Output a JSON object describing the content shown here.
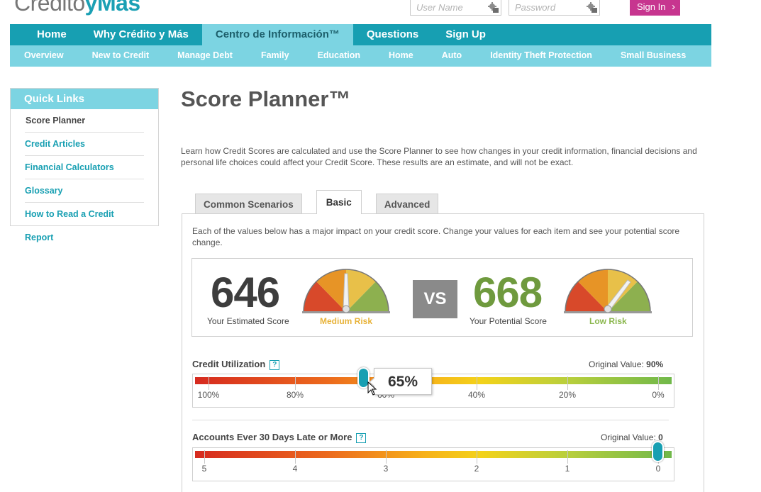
{
  "header": {
    "logo_part1": "Credito",
    "logo_part2": "yMás",
    "username_placeholder": "User Name",
    "password_placeholder": "Password",
    "signin_label": "Sign In",
    "signin_chevron": "›"
  },
  "mainnav": [
    "Home",
    "Why Crédito y Más",
    "Centro de Información™",
    "Questions",
    "Sign Up"
  ],
  "mainnav_active": 2,
  "subnav": [
    "Overview",
    "New to Credit",
    "Manage Debt",
    "Family",
    "Education",
    "Home",
    "Auto",
    "Identity Theft Protection",
    "Small Business"
  ],
  "quicklinks": {
    "title": "Quick Links",
    "items": [
      "Score Planner",
      "Credit Articles",
      "Financial Calculators",
      "Glossary",
      "How to Read a Credit Report"
    ]
  },
  "page": {
    "title": "Score Planner™",
    "intro": "Learn how Credit Scores are calculated and use the Score Planner to see how changes in your credit information, financial decisions and personal life choices could affect your Credit Score. These results are an estimate, and will not be exact."
  },
  "tabs": [
    "Common Scenarios",
    "Basic",
    "Advanced"
  ],
  "tabs_active": 1,
  "panel": {
    "description": "Each of the values below has a major impact on your credit score. Change your values for each item and see your potential score change."
  },
  "scores": {
    "estimated": {
      "value": "646",
      "caption": "Your Estimated Score",
      "risk": "Medium Risk",
      "color": "#3d3d3d",
      "risk_color": "#e8b33a"
    },
    "vs": "VS",
    "potential": {
      "value": "668",
      "caption": "Your Potential Score",
      "risk": "Low Risk",
      "color": "#6f9a3e",
      "risk_color": "#8bb74e"
    }
  },
  "factors": [
    {
      "label": "Credit Utilization",
      "help": "?",
      "original_label": "Original Value:",
      "original_value": "90%",
      "ticks": [
        "100%",
        "80%",
        "60%",
        "40%",
        "20%",
        "0%"
      ],
      "current_display": "65%"
    },
    {
      "label": "Accounts Ever 30 Days Late or More",
      "help": "?",
      "original_label": "Original Value:",
      "original_value": "0",
      "ticks": [
        "5",
        "4",
        "3",
        "2",
        "1",
        "0"
      ]
    }
  ],
  "colors": {
    "teal": "#179fb2",
    "light_teal": "#7cd4e2",
    "magenta": "#c7358f"
  }
}
